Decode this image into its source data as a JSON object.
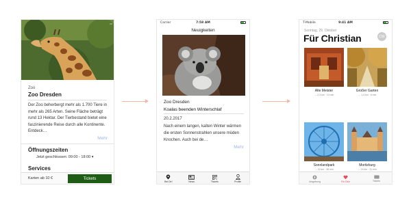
{
  "screen1": {
    "category": "Zoo",
    "title": "Zoo Dresden",
    "description": "Der Zoo beherbergt mehr als 1.700 Tiere in mehr als 265 Arten. Seine Fläche beträgt rund 13 Hektar. Der Tierbestand bietet eine faszinierende Reise durch alle Kontinente. Entdeck…",
    "more": "Mehr",
    "hours_heading": "Öffnungszeiten",
    "hours_text": "Jetzt geschlossen: 09:00 - 18:00",
    "hours_chevron": "▾",
    "services_heading": "Services",
    "price": "Karten ab 10 €",
    "tickets_button": "Tickets",
    "colors": {
      "button": "#1e5c16"
    }
  },
  "screen2": {
    "status": {
      "carrier": "Carrier",
      "time": "7:58 AM"
    },
    "nav_title": "Neuigkeiten",
    "source": "Zoo Dresden",
    "headline": "Koalas beenden Winterschlaf",
    "date": "20.2.2017",
    "text": "Nach einem langen, kalten Winter wärmen die ersten Sonnenstrahlen unsere müden Knochen. Auch bei de…",
    "more": "Mehr",
    "tabs": [
      {
        "label": "Bei Dir!",
        "icon": "location-pin-icon"
      },
      {
        "label": "News",
        "icon": "newspaper-icon"
      },
      {
        "label": "Tickets",
        "icon": "qr-code-icon"
      },
      {
        "label": "Profile",
        "icon": "person-icon"
      }
    ]
  },
  "screen3": {
    "status": {
      "carrier": "T-Mobile",
      "time": "9:41 AM"
    },
    "date": "Sonntag, 29. Oktober",
    "title": "Für Christian",
    "avatar": "CW",
    "cards": [
      {
        "name": "Alte Meister",
        "meta": "→ 2,3 km · 14 min"
      },
      {
        "name": "Großer Garten",
        "meta": "→ 1,4 km · 6 min"
      },
      {
        "name": "Sonnlandpark",
        "meta": "→ 22 km · 38 min"
      },
      {
        "name": "Moritzburg",
        "meta": "→ 24 km · 31 min"
      }
    ],
    "tabs": [
      {
        "label": "Umgebung",
        "icon": "compass-icon"
      },
      {
        "label": "Für Dich",
        "icon": "heart-icon"
      },
      {
        "label": "Tickets",
        "icon": "ticket-icon"
      }
    ],
    "colors": {
      "accent": "#e84a5f"
    }
  }
}
